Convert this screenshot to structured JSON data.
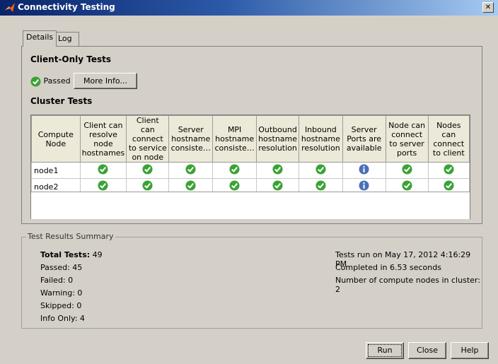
{
  "window": {
    "title": "Connectivity Testing",
    "close_label": "✕"
  },
  "tabs": [
    {
      "label": "Details"
    },
    {
      "label": "Log"
    }
  ],
  "client_only": {
    "heading": "Client-Only Tests",
    "status": "Passed",
    "more_info": "More Info..."
  },
  "cluster": {
    "heading": "Cluster Tests",
    "columns": [
      "Compute Node",
      "Client can resolve node hostnames",
      "Client can connect to service on node",
      "Server hostname consiste…",
      "MPI hostname consiste…",
      "Outbound hostname resolution",
      "Inbound hostname resolution",
      "Server Ports are available",
      "Node can connect to server ports",
      "Nodes can connect to client"
    ],
    "rows": [
      {
        "node": "node1",
        "results": [
          "pass",
          "pass",
          "pass",
          "pass",
          "pass",
          "pass",
          "info",
          "pass",
          "pass"
        ]
      },
      {
        "node": "node2",
        "results": [
          "pass",
          "pass",
          "pass",
          "pass",
          "pass",
          "pass",
          "info",
          "pass",
          "pass"
        ]
      }
    ]
  },
  "summary": {
    "legend": "Test Results Summary",
    "total_label": "Total Tests:",
    "total_value": "49",
    "passed": "Passed: 45",
    "failed": "Failed: 0",
    "warning": "Warning: 0",
    "skipped": "Skipped: 0",
    "info_only": "Info Only: 4",
    "run_on": "Tests run on May 17, 2012 4:16:29 PM",
    "completed": "Completed in 6.53 seconds",
    "nodes": "Number of compute nodes in cluster: 2"
  },
  "buttons": {
    "run": "Run",
    "close": "Close",
    "help": "Help"
  },
  "colors": {
    "pass": "#3aa335",
    "info": "#4a6fb8",
    "title_start": "#0a246a"
  }
}
